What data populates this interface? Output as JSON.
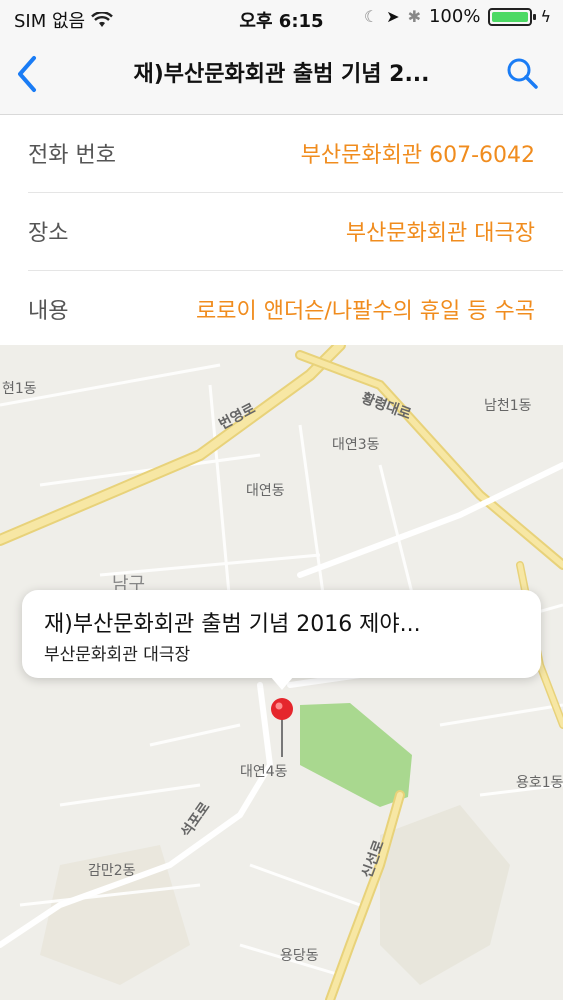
{
  "status": {
    "carrier": "SIM 없음",
    "time": "오후 6:15",
    "battery": "100%"
  },
  "nav": {
    "title": "재)부산문화회관 출범 기념 2..."
  },
  "details": [
    {
      "label": "전화 번호",
      "value": "부산문화회관 607-6042"
    },
    {
      "label": "장소",
      "value": "부산문화회관 대극장"
    },
    {
      "label": "내용",
      "value": "로로이 앤더슨/나팔수의 휴일 등 수곡"
    }
  ],
  "map": {
    "labels": [
      "현1동",
      "번영로",
      "황령대로",
      "남천1동",
      "대연3동",
      "대연동",
      "남구",
      "대연4동",
      "용호1동",
      "석포로",
      "감만2동",
      "신선로",
      "용당동"
    ]
  },
  "callout": {
    "title": "재)부산문화회관 출범 기념 2016 제야...",
    "subtitle": "부산문화회관 대극장"
  }
}
